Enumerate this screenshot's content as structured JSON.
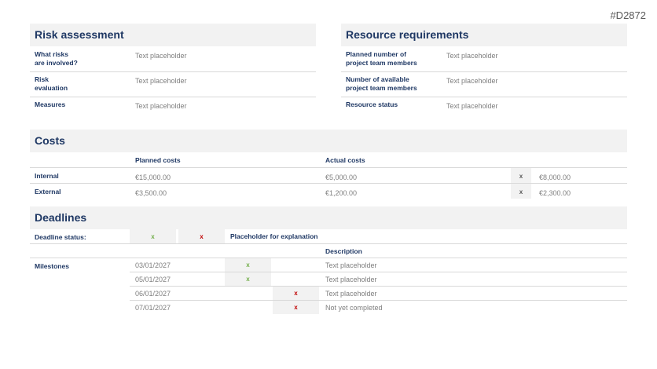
{
  "page_id": "#D2872",
  "risk": {
    "title": "Risk assessment",
    "rows": [
      {
        "label": "What risks\nare involved?",
        "value": "Text placeholder"
      },
      {
        "label": "Risk\nevaluation",
        "value": "Text placeholder"
      },
      {
        "label": "Measures",
        "value": "Text placeholder"
      }
    ]
  },
  "resources": {
    "title": "Resource requirements",
    "rows": [
      {
        "label": "Planned number of\nproject team members",
        "value": "Text placeholder"
      },
      {
        "label": "Number of available\nproject team members",
        "value": "Text placeholder"
      },
      {
        "label": "Resource status",
        "value": "Text placeholder"
      }
    ]
  },
  "costs": {
    "title": "Costs",
    "col_planned": "Planned costs",
    "col_actual": "Actual costs",
    "rows": [
      {
        "label": "Internal",
        "planned": "€15,000.00",
        "actual": "€5,000.00",
        "mark": "x",
        "extra": "€8,000.00"
      },
      {
        "label": "External",
        "planned": "€3,500.00",
        "actual": "€1,200.00",
        "mark": "x",
        "extra": "€2,300.00"
      }
    ]
  },
  "deadlines": {
    "title": "Deadlines",
    "status_label": "Deadline status:",
    "status_ok": "x",
    "status_bad": "x",
    "explanation": "Placeholder for explanation",
    "col_description": "Description",
    "milestones_label": "Milestones",
    "milestones": [
      {
        "date": "03/01/2027",
        "ok": "x",
        "bad": "",
        "description": "Text placeholder"
      },
      {
        "date": "05/01/2027",
        "ok": "x",
        "bad": "",
        "description": "Text placeholder"
      },
      {
        "date": "06/01/2027",
        "ok": "",
        "bad": "x",
        "description": "Text placeholder"
      },
      {
        "date": "07/01/2027",
        "ok": "",
        "bad": "x",
        "description": "Not yet completed"
      }
    ]
  }
}
